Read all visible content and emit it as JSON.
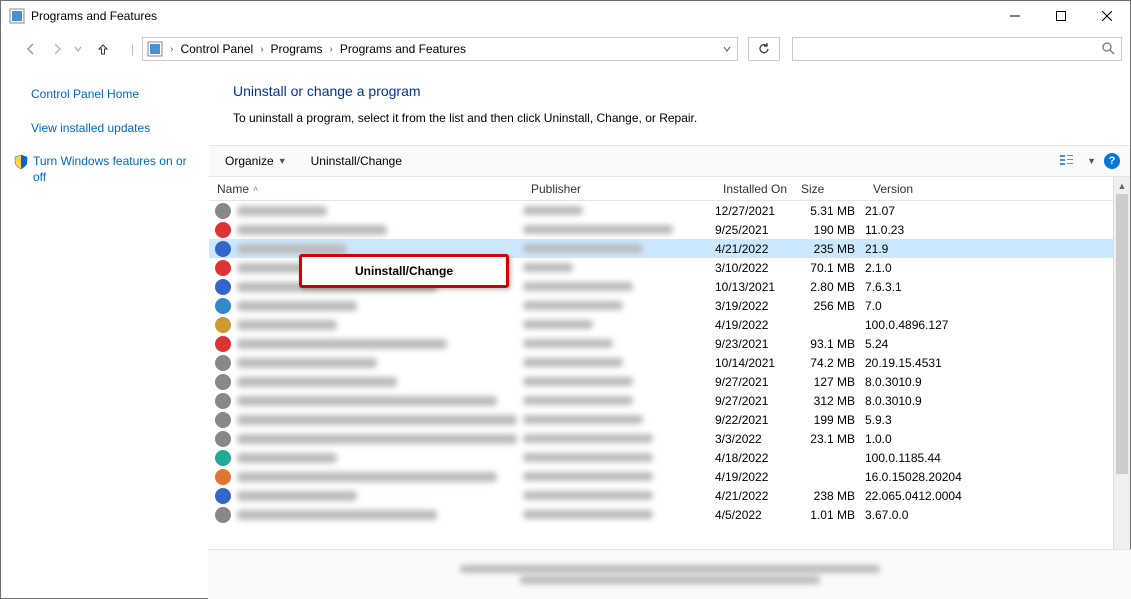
{
  "window": {
    "title": "Programs and Features"
  },
  "breadcrumb": {
    "root": "Control Panel",
    "mid": "Programs",
    "leaf": "Programs and Features"
  },
  "sidebar": {
    "home": "Control Panel Home",
    "updates": "View installed updates",
    "features": "Turn Windows features on or off"
  },
  "content": {
    "heading": "Uninstall or change a program",
    "subhead": "To uninstall a program, select it from the list and then click Uninstall, Change, or Repair."
  },
  "toolbar": {
    "organize": "Organize",
    "uninstall": "Uninstall/Change"
  },
  "columns": {
    "name": "Name",
    "publisher": "Publisher",
    "installed": "Installed On",
    "size": "Size",
    "version": "Version"
  },
  "context_menu": {
    "uninstall": "Uninstall/Change"
  },
  "rows": [
    {
      "icon": "#888",
      "nw": 90,
      "pw": 60,
      "installed": "12/27/2021",
      "size": "5.31 MB",
      "version": "21.07",
      "selected": false
    },
    {
      "icon": "#d33",
      "nw": 150,
      "pw": 150,
      "installed": "9/25/2021",
      "size": "190 MB",
      "version": "11.0.23",
      "selected": false
    },
    {
      "icon": "#36c",
      "nw": 110,
      "pw": 120,
      "installed": "4/21/2022",
      "size": "235 MB",
      "version": "21.9",
      "selected": true
    },
    {
      "icon": "#d33",
      "nw": 90,
      "pw": 50,
      "installed": "3/10/2022",
      "size": "70.1 MB",
      "version": "2.1.0",
      "selected": false
    },
    {
      "icon": "#36c",
      "nw": 200,
      "pw": 110,
      "installed": "10/13/2021",
      "size": "2.80 MB",
      "version": "7.6.3.1",
      "selected": false
    },
    {
      "icon": "#38c",
      "nw": 120,
      "pw": 100,
      "installed": "3/19/2022",
      "size": "256 MB",
      "version": "7.0",
      "selected": false
    },
    {
      "icon": "#c93",
      "nw": 100,
      "pw": 70,
      "installed": "4/19/2022",
      "size": "",
      "version": "100.0.4896.127",
      "selected": false
    },
    {
      "icon": "#d33",
      "nw": 210,
      "pw": 90,
      "installed": "9/23/2021",
      "size": "93.1 MB",
      "version": "5.24",
      "selected": false
    },
    {
      "icon": "#888",
      "nw": 140,
      "pw": 100,
      "installed": "10/14/2021",
      "size": "74.2 MB",
      "version": "20.19.15.4531",
      "selected": false
    },
    {
      "icon": "#888",
      "nw": 160,
      "pw": 110,
      "installed": "9/27/2021",
      "size": "127 MB",
      "version": "8.0.3010.9",
      "selected": false
    },
    {
      "icon": "#888",
      "nw": 260,
      "pw": 110,
      "installed": "9/27/2021",
      "size": "312 MB",
      "version": "8.0.3010.9",
      "selected": false
    },
    {
      "icon": "#888",
      "nw": 280,
      "pw": 120,
      "installed": "9/22/2021",
      "size": "199 MB",
      "version": "5.9.3",
      "selected": false
    },
    {
      "icon": "#888",
      "nw": 280,
      "pw": 130,
      "installed": "3/3/2022",
      "size": "23.1 MB",
      "version": "1.0.0",
      "selected": false
    },
    {
      "icon": "#2a9",
      "nw": 100,
      "pw": 130,
      "installed": "4/18/2022",
      "size": "",
      "version": "100.0.1185.44",
      "selected": false
    },
    {
      "icon": "#d73",
      "nw": 260,
      "pw": 130,
      "installed": "4/19/2022",
      "size": "",
      "version": "16.0.15028.20204",
      "selected": false
    },
    {
      "icon": "#36c",
      "nw": 120,
      "pw": 130,
      "installed": "4/21/2022",
      "size": "238 MB",
      "version": "22.065.0412.0004",
      "selected": false
    },
    {
      "icon": "#888",
      "nw": 200,
      "pw": 130,
      "installed": "4/5/2022",
      "size": "1.01 MB",
      "version": "3.67.0.0",
      "selected": false
    }
  ]
}
